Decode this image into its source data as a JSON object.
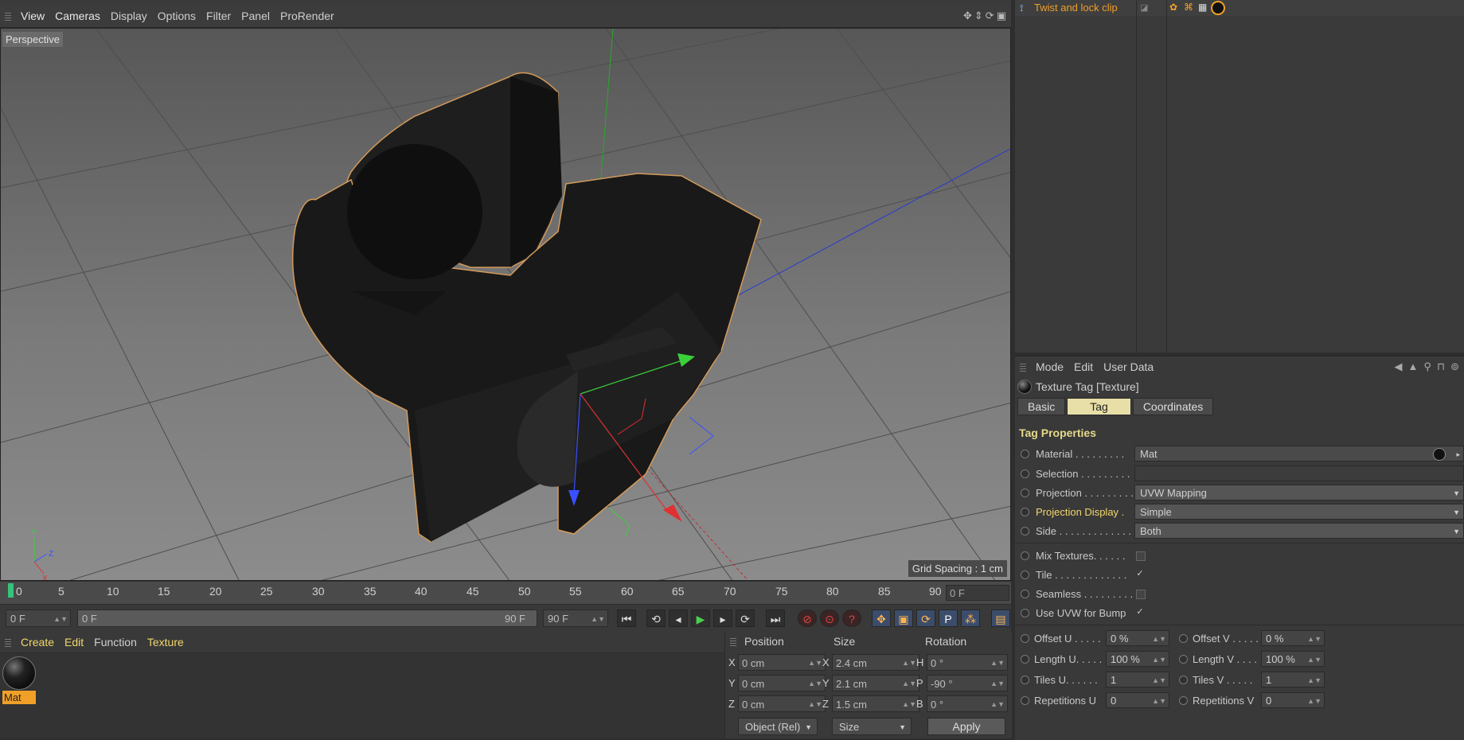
{
  "viewport": {
    "menu": [
      "View",
      "Cameras",
      "Display",
      "Options",
      "Filter",
      "Panel",
      "ProRender"
    ],
    "camera_label": "Perspective",
    "grid_spacing": "Grid Spacing : 1 cm"
  },
  "timeline": {
    "ticks": [
      "0",
      "5",
      "10",
      "15",
      "20",
      "25",
      "30",
      "35",
      "40",
      "45",
      "50",
      "55",
      "60",
      "65",
      "70",
      "75",
      "80",
      "85",
      "90"
    ],
    "current_frame": "0 F",
    "start_frame": "0 F",
    "range_start": "0 F",
    "range_end": "90 F",
    "end_frame": "90 F"
  },
  "material_manager": {
    "menu": [
      "Create",
      "Edit",
      "Function",
      "Texture"
    ],
    "material_name": "Mat"
  },
  "coordinates": {
    "headers": {
      "position": "Position",
      "size": "Size",
      "rotation": "Rotation"
    },
    "rows": [
      {
        "pos_axis": "X",
        "pos": "0 cm",
        "size_axis": "X",
        "size": "2.4 cm",
        "rot_axis": "H",
        "rot": "0 °"
      },
      {
        "pos_axis": "Y",
        "pos": "0 cm",
        "size_axis": "Y",
        "size": "2.1 cm",
        "rot_axis": "P",
        "rot": "-90 °"
      },
      {
        "pos_axis": "Z",
        "pos": "0 cm",
        "size_axis": "Z",
        "size": "1.5 cm",
        "rot_axis": "B",
        "rot": "0 °"
      }
    ],
    "mode_dropdown": "Object (Rel)",
    "size_dropdown": "Size",
    "apply_label": "Apply"
  },
  "object_manager": {
    "object_name": "Twist and lock clip"
  },
  "attribute_manager": {
    "menu": [
      "Mode",
      "Edit",
      "User Data"
    ],
    "title": "Texture Tag [Texture]",
    "tabs": [
      "Basic",
      "Tag",
      "Coordinates"
    ],
    "section_title": "Tag Properties",
    "material_label": "Material . . . . . . . . .",
    "material_value": "Mat",
    "selection_label": "Selection . . . . . . . . .",
    "selection_value": "",
    "projection_label": "Projection . . . . . . . . .",
    "projection_value": "UVW Mapping",
    "projection_display_label": "Projection Display .",
    "projection_display_value": "Simple",
    "side_label": "Side . . . . . . . . . . . . .",
    "side_value": "Both",
    "mix_label": "Mix Textures. . . . . .",
    "tile_label": "Tile . . . . . . . . . . . . .",
    "seamless_label": "Seamless . . . . . . . . .",
    "uvw_bump_label": "Use UVW for Bump",
    "check_mark": "✓",
    "offset_u_label": "Offset U . . . . .",
    "offset_u": "0 %",
    "offset_v_label": "Offset V . . . . .",
    "offset_v": "0 %",
    "length_u_label": "Length U. . . . .",
    "length_u": "100 %",
    "length_v_label": "Length V . . . .",
    "length_v": "100 %",
    "tiles_u_label": "Tiles U. . . . . .",
    "tiles_u": "1",
    "tiles_v_label": "Tiles V . . . . .",
    "tiles_v": "1",
    "rep_u_label": "Repetitions U",
    "rep_u": "0",
    "rep_v_label": "Repetitions V",
    "rep_v": "0"
  },
  "colors": {
    "accent_orange": "#f0a028",
    "accent_yellow": "#f2d76b",
    "active_tab": "#e8dfa8"
  }
}
